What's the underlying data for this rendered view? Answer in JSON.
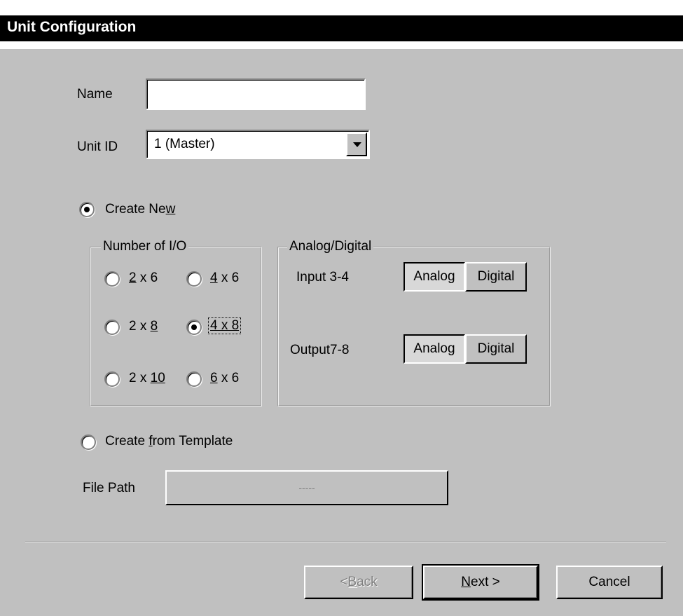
{
  "window": {
    "title": "Unit Configuration"
  },
  "form": {
    "name_label": "Name",
    "name_value": "",
    "unit_id_label": "Unit ID",
    "unit_id_value": "1 (Master)"
  },
  "create_new": {
    "label_pre": "Create Ne",
    "label_accel": "w",
    "label_post": "",
    "checked": true
  },
  "io_group": {
    "title": "Number of I/O",
    "options": [
      {
        "pre": "",
        "accel": "2",
        "post": " x 6",
        "checked": false
      },
      {
        "pre": "",
        "accel": "4",
        "post": " x 6",
        "checked": false
      },
      {
        "pre": "2 x ",
        "accel": "8",
        "post": "",
        "checked": false
      },
      {
        "pre": "",
        "accel": "4 x 8",
        "post": "",
        "checked": true
      },
      {
        "pre": "2 x ",
        "accel": "10",
        "post": "",
        "checked": false
      },
      {
        "pre": "",
        "accel": "6",
        "post": " x 6",
        "checked": false
      }
    ]
  },
  "ad_group": {
    "title": "Analog/Digital",
    "input_label": "Input 3-4",
    "output_label": "Output7-8",
    "analog_label": "Analog",
    "digital_label": "Digital"
  },
  "create_template": {
    "label_pre": "Create ",
    "label_accel": "f",
    "label_post": "rom Template",
    "checked": false
  },
  "file_path": {
    "label": "File Path",
    "value": "-----"
  },
  "buttons": {
    "back_pre": "< ",
    "back_accel": "B",
    "back_post": "ack",
    "next_accel": "N",
    "next_post": "ext >",
    "cancel": "Cancel"
  },
  "colors": {
    "face": "#c0c0c0",
    "titlebar": "#000000",
    "disabled_text": "#808080"
  }
}
